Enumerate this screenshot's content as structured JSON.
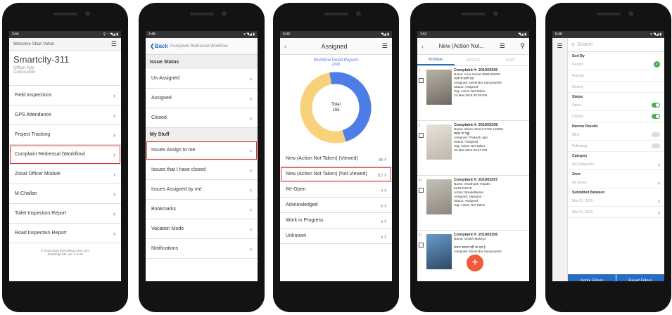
{
  "phone1": {
    "status_time": "3:44",
    "status_icons": "⚲ ◔ ◥◢ ▮",
    "welcome": "Welcome Shari Vohal",
    "app_title": "Smartcity-311",
    "subtitle1": "Officer App",
    "subtitle2": "Corporation",
    "menu": [
      {
        "label": "Field Inspections"
      },
      {
        "label": "GPS Attendance"
      },
      {
        "label": "Project Tracking"
      },
      {
        "label": "Complaint Redressal (Workflow)"
      },
      {
        "label": "Zonal Officer Module"
      },
      {
        "label": "M-Challan"
      },
      {
        "label": "Toilet Inspection Report"
      },
      {
        "label": "Road Inspection Report"
      }
    ],
    "footer1": "© 2018 2019 Everything Civic.com",
    "footer2": "Smartcity-311 Ver. 4.0.23"
  },
  "phone2": {
    "status_time": "3:48",
    "status_icons": "▾ ◥◢ ▮",
    "back_label": "Back",
    "header_title": "Complaint Redressal Workflow",
    "section1": "Issue Status",
    "status_items": [
      {
        "label": "Un-Assigned"
      },
      {
        "label": "Assigned"
      },
      {
        "label": "Closed"
      }
    ],
    "section2": "My Stuff",
    "stuff_items": [
      {
        "label": "Issues Assign to me"
      },
      {
        "label": "Issues that I have closed"
      },
      {
        "label": "Issues Assigned by me"
      },
      {
        "label": "Bookmarks"
      },
      {
        "label": "Vacation Mode"
      },
      {
        "label": "Notifications"
      }
    ]
  },
  "phone3": {
    "status_time": "5:00",
    "status_icons": "◥◢ ▮",
    "title": "Assigned",
    "report_title": "Workflow Detail Reports",
    "report_count": "(All)",
    "donut_center": "Total",
    "donut_total": "155",
    "donut_colors": {
      "blue": "#4d7ee8",
      "yellow": "#f8d27a"
    },
    "donut_fraction_blue": 0.48,
    "items": [
      {
        "label": "New (Action Not Taken) (Viewed)",
        "count": "89"
      },
      {
        "label": "New (Action Not Taken) (Not Viewed)",
        "count": "112"
      },
      {
        "label": "Re-Open",
        "count": "4"
      },
      {
        "label": "Acknowledged",
        "count": "8"
      },
      {
        "label": "Work in Progress",
        "count": "3"
      },
      {
        "label": "Unknown",
        "count": "4"
      }
    ]
  },
  "phone4": {
    "status_time": "1:51",
    "status_icons": "◥◢ ▮",
    "title": "New (Action Not...",
    "tabs": [
      "NORMAL",
      "URGENT",
      "DEBT"
    ],
    "cards": [
      {
        "num": "1",
        "complaint": "Complaint #: 201903206",
        "line1": "Name: Arun Kumar 8094182206",
        "line2": "नाली में पानी भरा",
        "line3": "Assigned: Devendra Suryavanshi",
        "line4": "Status: Assigned",
        "line5": "Tag: Action Not Taken",
        "line6": "22-Mar-2019 06:39 PM"
      },
      {
        "num": "2",
        "complaint": "Complaint #: 201903208",
        "line1": "Name: Shanu Merch 0728 143094",
        "line2": "सड़क पर गड्ढा",
        "line3": "Assigned: Prakash Jain",
        "line4": "Status: Assigned",
        "line5": "Tag: Action Not Taken",
        "line6": "22-Mar-2019 06:42 PM"
      },
      {
        "num": "31",
        "complaint": "Complaint #: 201903207",
        "line1": "Name: Shashank Tripathi",
        "line2": "8140411078",
        "line3": "Action: Break/Barrier",
        "line4": "Assigned: Harupha",
        "line5": "Status: Assigned",
        "line6": "Tag: Action Not Taken"
      },
      {
        "num": "31",
        "complaint": "Complaint #: 201903206",
        "line1": "Name: Shubh Malviya",
        "line2": "",
        "line3": "कचरा उठाया नहीं जा रहा है",
        "line4": "Assigned: Devendra Suryavanshi",
        "line5": "",
        "line6": ""
      }
    ]
  },
  "phone5": {
    "status_time": "5:48",
    "status_icons": "▾ ◥◢ ▮",
    "search_placeholder": "Search",
    "sort_by": "Sort By",
    "sort_options": [
      "Recent",
      "Popular",
      "Nearby"
    ],
    "status_label": "Status",
    "status_options": [
      "Open",
      "Closed"
    ],
    "narrow_label": "Narrow Results",
    "narrow_options": [
      "Mine",
      "Following"
    ],
    "category_label": "Category",
    "category_value": "All Categories",
    "zone_label": "Zone",
    "zone_value": "All Zones",
    "submitted_label": "Submitted Between",
    "date1": "Mar 01, 2019",
    "date2": "Mar 31, 2019",
    "apply_label": "Apply Filters",
    "reset_label": "Reset Filters"
  }
}
